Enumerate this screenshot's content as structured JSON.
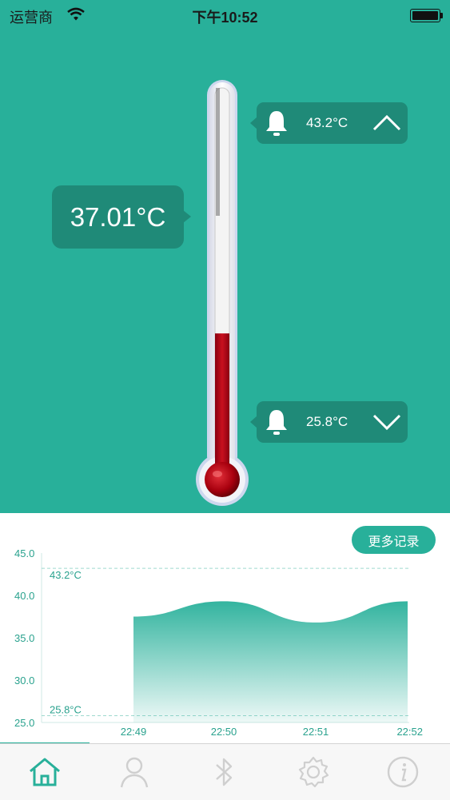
{
  "status_bar": {
    "carrier": "运营商",
    "time": "下午10:52"
  },
  "current_temperature": "37.01°C",
  "thermometer_fill_fraction": 0.36,
  "alarm_high": {
    "value": "43.2°C",
    "icon": "bell-icon",
    "chevron": "chevron-up-icon"
  },
  "alarm_low": {
    "value": "25.8°C",
    "icon": "bell-icon",
    "chevron": "chevron-down-icon"
  },
  "more_records_label": "更多记录",
  "chart_data": {
    "type": "area",
    "x": [
      "22:49",
      "22:50",
      "22:51",
      "22:52"
    ],
    "series": [
      {
        "values": [
          37.5,
          39.3,
          36.8,
          39.3
        ]
      }
    ],
    "ylim": [
      25.0,
      45.0
    ],
    "yticks": [
      "45.0",
      "40.0",
      "35.0",
      "30.0",
      "25.0"
    ],
    "reference_lines": [
      {
        "value": 43.2,
        "label": "43.2°C"
      },
      {
        "value": 25.8,
        "label": "25.8°C"
      }
    ],
    "fill_color": "#28b09a"
  },
  "tabs": [
    {
      "icon": "home-icon",
      "active": true
    },
    {
      "icon": "user-icon",
      "active": false
    },
    {
      "icon": "bluetooth-icon",
      "active": false
    },
    {
      "icon": "gear-icon",
      "active": false
    },
    {
      "icon": "info-icon",
      "active": false
    }
  ],
  "colors": {
    "accent": "#28b09a",
    "accent_dark": "#1f8a78",
    "mercury": "#b00010"
  }
}
